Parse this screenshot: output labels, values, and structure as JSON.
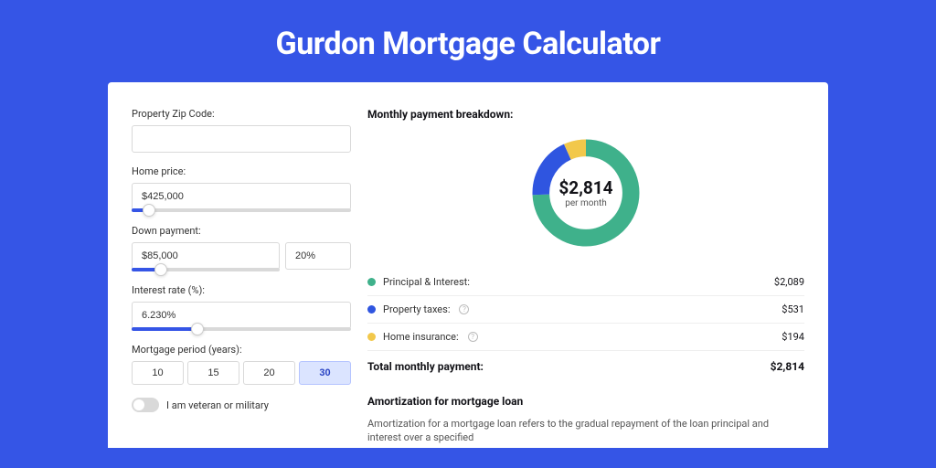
{
  "title": "Gurdon Mortgage Calculator",
  "form": {
    "zip": {
      "label": "Property Zip Code:",
      "value": ""
    },
    "home_price": {
      "label": "Home price:",
      "value": "$425,000",
      "slider_pct": 8
    },
    "down_payment": {
      "label": "Down payment:",
      "value": "$85,000",
      "pct_value": "20%",
      "slider_pct": 20
    },
    "interest_rate": {
      "label": "Interest rate (%):",
      "value": "6.230%",
      "slider_pct": 30
    },
    "period": {
      "label": "Mortgage period (years):",
      "options": [
        "10",
        "15",
        "20",
        "30"
      ],
      "selected": "30"
    },
    "veteran": {
      "label": "I am veteran or military",
      "checked": false
    }
  },
  "breakdown": {
    "heading": "Monthly payment breakdown:",
    "center_amount": "$2,814",
    "center_sub": "per month",
    "items": [
      {
        "label": "Principal & Interest:",
        "value": "$2,089",
        "color": "#3fb18b",
        "info": false
      },
      {
        "label": "Property taxes:",
        "value": "$531",
        "color": "#2f55e0",
        "info": true
      },
      {
        "label": "Home insurance:",
        "value": "$194",
        "color": "#f2c84b",
        "info": true
      }
    ],
    "total_label": "Total monthly payment:",
    "total_value": "$2,814"
  },
  "chart_data": {
    "type": "pie",
    "title": "Monthly payment breakdown",
    "series": [
      {
        "name": "Principal & Interest",
        "value": 2089,
        "color": "#3fb18b"
      },
      {
        "name": "Property taxes",
        "value": 531,
        "color": "#2f55e0"
      },
      {
        "name": "Home insurance",
        "value": 194,
        "color": "#f2c84b"
      }
    ],
    "total": 2814,
    "center_label": "$2,814 per month"
  },
  "amortization": {
    "heading": "Amortization for mortgage loan",
    "text": "Amortization for a mortgage loan refers to the gradual repayment of the loan principal and interest over a specified"
  }
}
